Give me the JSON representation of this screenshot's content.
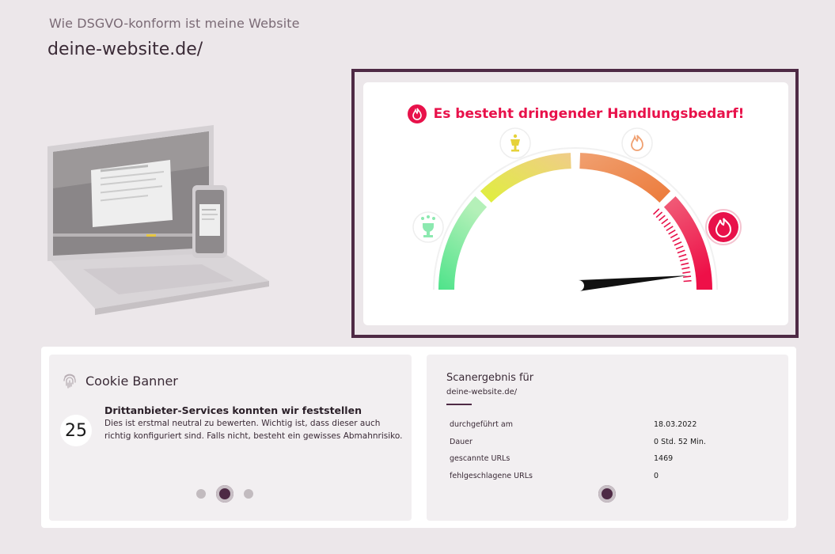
{
  "header": {
    "subtitle": "Wie DSGVO-konform ist meine Website",
    "site": "deine-website.de/"
  },
  "gauge": {
    "alert_text": "Es besteht dringender Handlungsbedarf!",
    "level": 0.96,
    "icons": [
      "trophy-icon",
      "chalice-icon",
      "flame-icon",
      "flame-icon-active"
    ],
    "colors": {
      "alert": "#e8114a",
      "frame": "#4e2a45"
    }
  },
  "cookie_panel": {
    "title": "Cookie Banner",
    "count": "25",
    "heading": "Drittanbieter-Services konnten wir feststellen",
    "description": "Dies ist erstmal neutral zu bewerten. Wichtig ist, dass dieser auch richtig konfiguriert sind. Falls nicht, besteht ein gewisses Abmahnrisiko.",
    "pager": {
      "count": 3,
      "active": 2
    }
  },
  "scan_panel": {
    "title": "Scanergebnis für",
    "site": "deine-website.de/",
    "rows": [
      {
        "label": "durchgeführt am",
        "value": "18.03.2022"
      },
      {
        "label": "Dauer",
        "value": "0 Std. 52 Min."
      },
      {
        "label": "gescannte URLs",
        "value": "1469"
      },
      {
        "label": "fehlgeschlagene URLs",
        "value": "0"
      }
    ],
    "pager": {
      "count": 1,
      "active": 1
    }
  }
}
